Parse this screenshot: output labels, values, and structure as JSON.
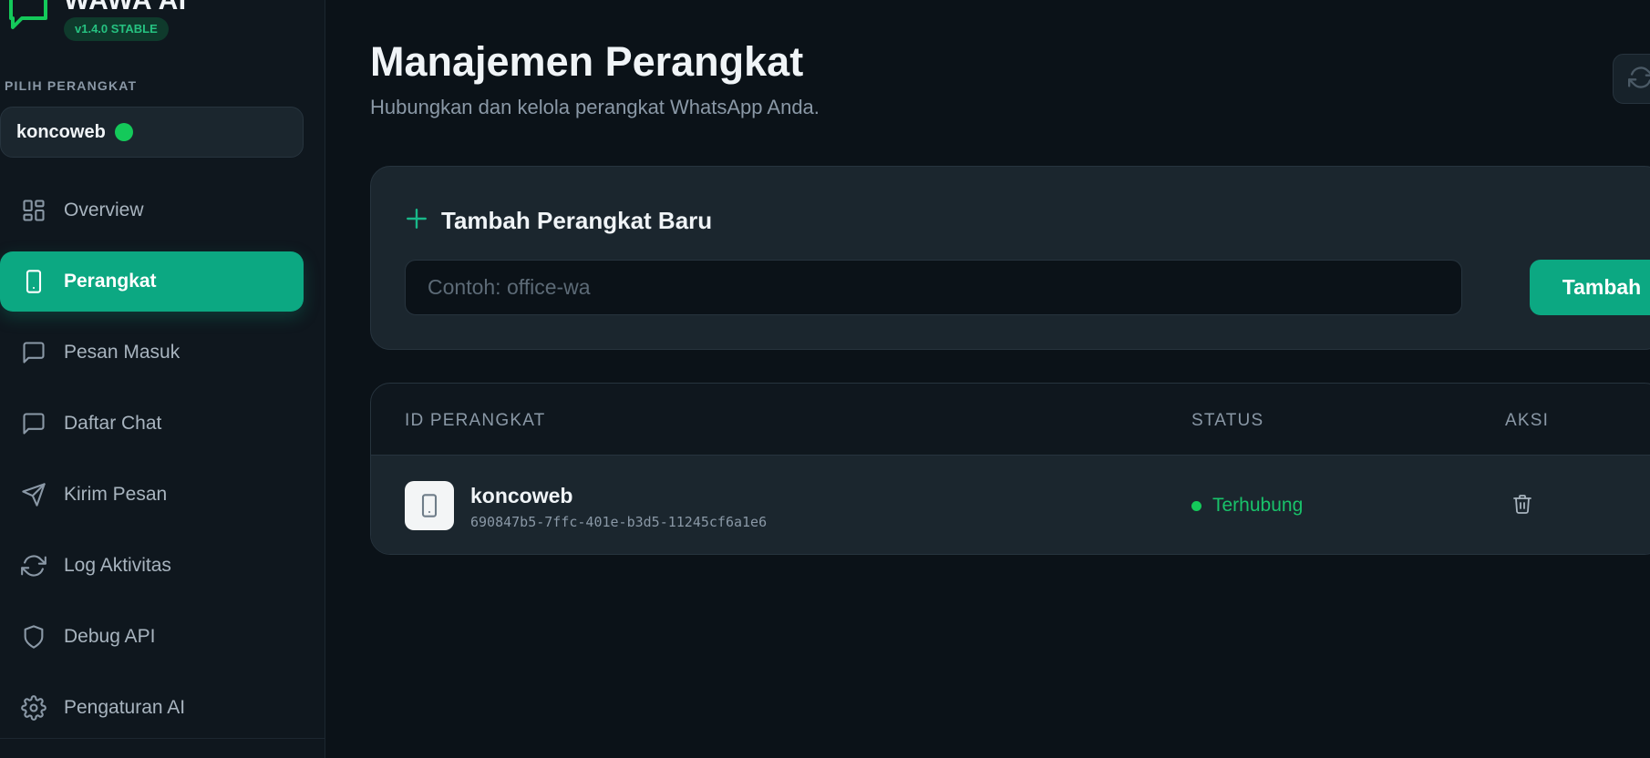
{
  "brand": {
    "name": "WAWA AI",
    "version": "v1.4.0 STABLE",
    "logo_icon": "chat-bubble-icon",
    "accent": "#14c95a"
  },
  "sidebar": {
    "section_label": "PILIH PERANGKAT",
    "selected_device": "koncoweb",
    "selected_status_color": "#14c95a",
    "items": [
      {
        "label": "Overview",
        "icon": "grid-icon",
        "active": false
      },
      {
        "label": "Perangkat",
        "icon": "smartphone-icon",
        "active": true
      },
      {
        "label": "Pesan Masuk",
        "icon": "message-icon",
        "active": false
      },
      {
        "label": "Daftar Chat",
        "icon": "message-icon",
        "active": false
      },
      {
        "label": "Kirim Pesan",
        "icon": "send-icon",
        "active": false
      },
      {
        "label": "Log Aktivitas",
        "icon": "refresh-icon",
        "active": false
      },
      {
        "label": "Debug API",
        "icon": "shield-icon",
        "active": false
      },
      {
        "label": "Pengaturan AI",
        "icon": "gear-icon",
        "active": false
      }
    ]
  },
  "header": {
    "title": "Manajemen Perangkat",
    "subtitle": "Hubungkan dan kelola perangkat WhatsApp Anda.",
    "refresh_icon": "refresh-icon"
  },
  "add_device": {
    "title": "Tambah Perangkat Baru",
    "input_value": "",
    "input_placeholder": "Contoh: office-wa",
    "button_label": "Tambah",
    "accent": "#0ca882"
  },
  "table": {
    "columns": [
      "ID PERANGKAT",
      "STATUS",
      "AKSI"
    ],
    "rows": [
      {
        "name": "koncoweb",
        "uuid": "690847b5-7ffc-401e-b3d5-11245cf6a1e6",
        "status": "Terhubung",
        "status_color": "#19c26a",
        "icon": "smartphone-icon",
        "action_icon": "trash-icon"
      }
    ]
  }
}
